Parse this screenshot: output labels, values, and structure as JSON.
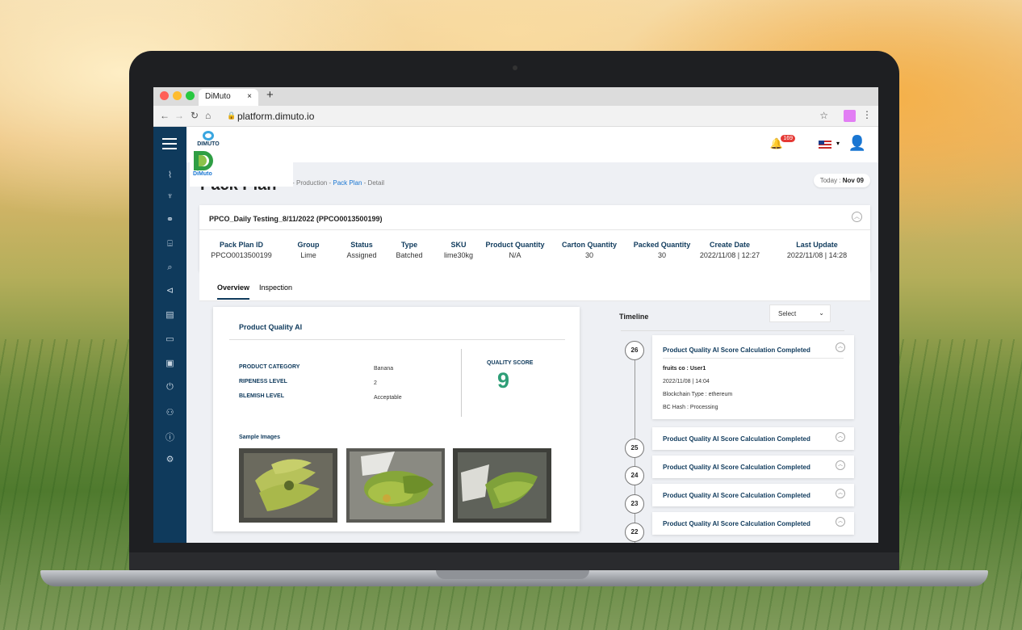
{
  "browser": {
    "tab_title": "DiMuto",
    "tab_close": "×",
    "new_tab": "+",
    "url": "platform.dimuto.io"
  },
  "header": {
    "logo_text": "DIMUTO",
    "logo_popup_text": "DiMuto",
    "notification_count": "169"
  },
  "page": {
    "title": "Pack Plan",
    "breadcrumb": {
      "home": "⌂",
      "sep": "-",
      "production": "Production",
      "pack_plan": "Pack Plan",
      "detail": "Detail"
    },
    "today_label": "Today :",
    "today_value": "Nov 09"
  },
  "plan": {
    "title": "PPCO_Daily Testing_8/11/2022 (PPCO0013500199)",
    "columns": [
      {
        "header": "Pack Plan ID",
        "value": "PPCO0013500199"
      },
      {
        "header": "Group",
        "value": "Lime"
      },
      {
        "header": "Status",
        "value": "Assigned"
      },
      {
        "header": "Type",
        "value": "Batched"
      },
      {
        "header": "SKU",
        "value": "lime30kg"
      },
      {
        "header": "Product Quantity",
        "value": "N/A"
      },
      {
        "header": "Carton Quantity",
        "value": "30"
      },
      {
        "header": "Packed Quantity",
        "value": "30"
      },
      {
        "header": "Create Date",
        "value": "2022/11/08 | 12:27"
      },
      {
        "header": "Last Update",
        "value": "2022/11/08 | 14:28"
      }
    ]
  },
  "tabs": [
    {
      "label": "Overview",
      "active": true
    },
    {
      "label": "Inspection",
      "active": false
    }
  ],
  "quality": {
    "title": "Product Quality AI",
    "fields": [
      {
        "label": "PRODUCT CATEGORY",
        "value": "Banana"
      },
      {
        "label": "RIPENESS LEVEL",
        "value": "2"
      },
      {
        "label": "BLEMISH LEVEL",
        "value": "Acceptable"
      }
    ],
    "score_label": "QUALITY SCORE",
    "score_value": "9",
    "sample_label": "Sample Images"
  },
  "timeline": {
    "title": "Timeline",
    "select_label": "Select",
    "events": [
      {
        "num": "26",
        "title": "Product Quality AI Score Calculation Completed",
        "expanded": true,
        "company": "fruits co : User1",
        "datetime": "2022/11/08 | 14:04",
        "chain": "Blockchain Type : ethereum",
        "hash": "BC Hash : Processing"
      },
      {
        "num": "25",
        "title": "Product Quality AI Score Calculation Completed",
        "expanded": false
      },
      {
        "num": "24",
        "title": "Product Quality AI Score Calculation Completed",
        "expanded": false
      },
      {
        "num": "23",
        "title": "Product Quality AI Score Calculation Completed",
        "expanded": false
      },
      {
        "num": "22",
        "title": "Product Quality AI Score Calculation Completed",
        "expanded": false
      }
    ]
  },
  "colors": {
    "sidebar": "#0f3a5c",
    "accent": "#1976d2",
    "score": "#2e9e77",
    "badge": "#e53935"
  }
}
